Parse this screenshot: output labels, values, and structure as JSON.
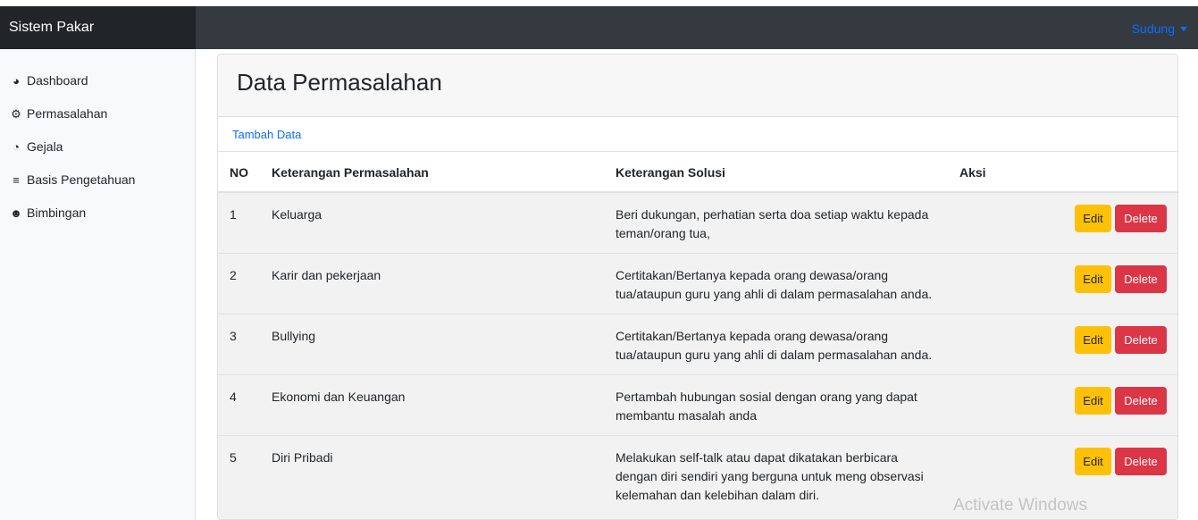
{
  "brand": "Sistem Pakar",
  "user_menu": "Sudung",
  "sidebar": {
    "items": [
      {
        "label": "Dashboard",
        "icon": "tachometer-icon"
      },
      {
        "label": "Permasalahan",
        "icon": "cogs-icon"
      },
      {
        "label": "Gejala",
        "icon": "pie-chart-icon"
      },
      {
        "label": "Basis Pengetahuan",
        "icon": "sliders-icon"
      },
      {
        "label": "Bimbingan",
        "icon": "users-icon"
      }
    ]
  },
  "page_title": "Data Permasalahan",
  "add_link": "Tambah Data",
  "table": {
    "headers": [
      "NO",
      "Keterangan Permasalahan",
      "Keterangan Solusi",
      "Aksi"
    ],
    "rows": [
      {
        "no": "1",
        "ket": "Keluarga",
        "solusi": "Beri dukungan, perhatian serta doa setiap waktu kepada teman/orang tua,"
      },
      {
        "no": "2",
        "ket": "Karir dan pekerjaan",
        "solusi": "Certitakan/Bertanya kepada orang dewasa/orang tua/ataupun guru yang ahli di dalam permasalahan anda."
      },
      {
        "no": "3",
        "ket": "Bullying",
        "solusi": "Certitakan/Bertanya kepada orang dewasa/orang tua/ataupun guru yang ahli di dalam permasalahan anda."
      },
      {
        "no": "4",
        "ket": "Ekonomi dan Keuangan",
        "solusi": "Pertambah hubungan sosial dengan orang yang dapat membantu masalah anda"
      },
      {
        "no": "5",
        "ket": "Diri Pribadi",
        "solusi": "Melakukan self-talk atau dapat dikatakan berbicara dengan diri sendiri yang berguna untuk meng observasi kelemahan dan kelebihan dalam diri."
      }
    ],
    "edit_label": "Edit",
    "delete_label": "Delete"
  },
  "watermark": "Activate Windows",
  "colors": {
    "navbar": "#343a40",
    "brand_bg": "#212529",
    "link": "#0d6efd",
    "edit": "#ffc107",
    "delete": "#dc3545"
  }
}
